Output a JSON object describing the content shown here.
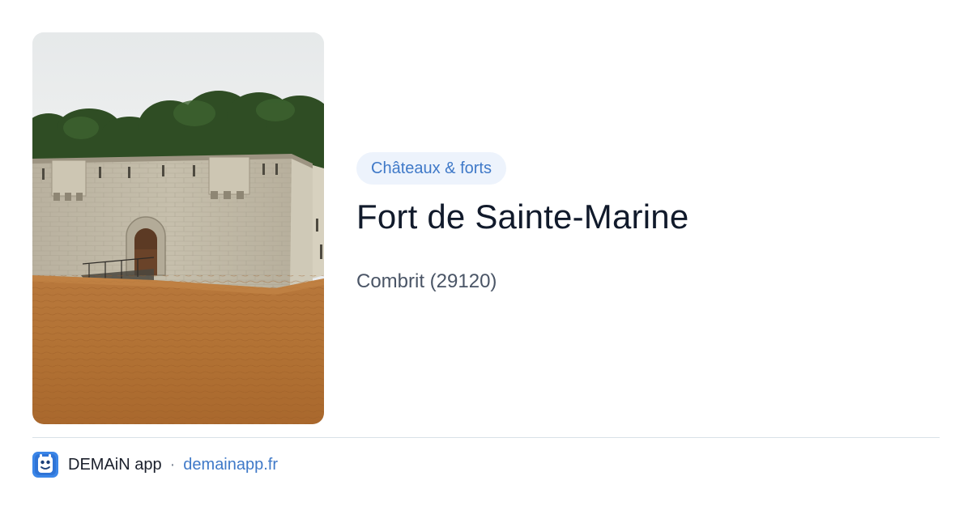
{
  "photo": {
    "alt": "Fort de Sainte-Marine"
  },
  "category": {
    "label": "Châteaux & forts"
  },
  "place": {
    "title": "Fort de Sainte-Marine",
    "location": "Combrit (29120)"
  },
  "footer": {
    "app_icon": "app-logo-icon",
    "app_name": "DEMAiN app",
    "separator": "·",
    "domain": "demainapp.fr"
  },
  "colors": {
    "accent": "#3f79c8",
    "tag_background": "#edf3fc",
    "title": "#111a2b",
    "subtitle": "#4a5566",
    "divider": "#d9e1e7"
  }
}
